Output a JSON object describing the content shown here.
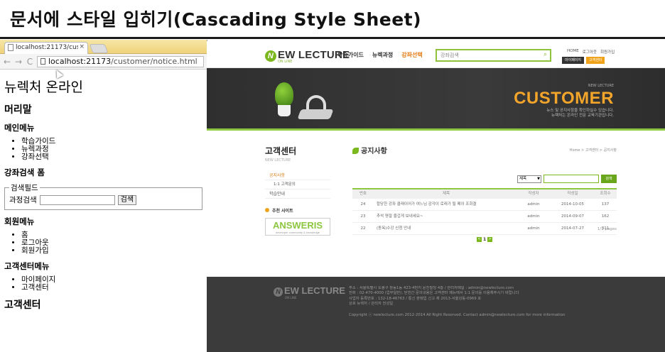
{
  "slide": {
    "title": "문서에 스타일 입히기(Cascading Style Sheet)"
  },
  "browser": {
    "tab_title": "localhost:21173/custome",
    "tab_close": "×",
    "url_host": "localhost:21173",
    "url_path": "/customer/notice.html"
  },
  "page": {
    "site_title": "뉴렉처 온라인",
    "header_heading": "머리말",
    "main_menu_heading": "메인메뉴",
    "main_menu": [
      "학습가이드",
      "뉴렉과정",
      "강좌선택"
    ],
    "search_heading": "강좌검색 폼",
    "search_legend": "검색필드",
    "search_label": "과정검색",
    "search_button": "검색",
    "member_menu_heading": "회원메뉴",
    "member_menu": [
      "홈",
      "로그아웃",
      "회원가입"
    ],
    "customer_menu_heading": "고객센터메뉴",
    "customer_menu": [
      "마이페이지",
      "고객센터"
    ],
    "customer_heading": "고객센터"
  },
  "site": {
    "logo_main": "EW LECTURE",
    "logo_n": "N",
    "logo_sub": "ON LINE",
    "nav": [
      "학습가이드",
      "뉴렉과정",
      "강좌선택"
    ],
    "search_placeholder": "강좌검색",
    "search_icon": "magnifier-icon",
    "util_links": [
      "HOME",
      "로그아웃",
      "회원가입"
    ],
    "util_buttons": [
      "마이페이지",
      "고객센터"
    ],
    "hero_sub": "NEW LECTURE",
    "hero_title": "CUSTOMER",
    "hero_desc_1": "뉴스 및 공지사항을 확인하실수 있습니다.",
    "hero_desc_2": "뉴렉처는 온라인 전문 교육기관입니다.",
    "lnb_title": "고객센터",
    "lnb_eng": "NEW LECTURE",
    "lnb_items": [
      "공지사항",
      "1:1 고객문의",
      "학습안내"
    ],
    "recommend_label": "추천 사이트",
    "answeris_logo": "ANSWERIS",
    "answeris_sub": "developer community & knowledge",
    "main_title": "공지사항",
    "breadcrumb": "Home > 고객센터 > 공지사항",
    "filter_select": "제목",
    "filter_button": "검색",
    "board_headers": {
      "no": "번호",
      "title": "제목",
      "author": "작성자",
      "date": "작성일",
      "views": "조회수"
    },
    "board_rows": [
      {
        "no": "24",
        "title": "합당한 강좌 클래이어가 여느님 감각이 로래가 될 페이 조회결",
        "author": "admin",
        "date": "2014-10-05",
        "views": "137"
      },
      {
        "no": "23",
        "title": "추석 명절 즐겁게 보내세요~",
        "author": "admin",
        "date": "2014-09-07",
        "views": "162"
      },
      {
        "no": "22",
        "title": "(동옥)수강 신청 안내",
        "author": "admin",
        "date": "2014-07-27",
        "views": "311"
      }
    ],
    "page_info": "1/1 pages",
    "page_current": "1",
    "page_prev": "<",
    "page_next": ">",
    "footer_lines": [
      "주소 : 서울특별시 도봉구 창동1동 423-4번지 윤진빌딩 4층 / 관리자메일 : admin@newlecture.com",
      "전화 : 02-470-4000 (업무일반), 닫힌간 문의내용은 고객센터 메뉴에서 1:1 문의를 이용해주시기 바랍니다",
      "사업자 등록번호 : 132-18-46763 / 통신 판매업 신고 제 2013-서울강동-0969 호",
      "상호 뉴렉처 / 관리자 전성일"
    ],
    "footer_copyright": "Copyright ⓒ newlecture.com 2012-2014 All Right Reserved. Contact admin@newlecture.com for more information"
  }
}
